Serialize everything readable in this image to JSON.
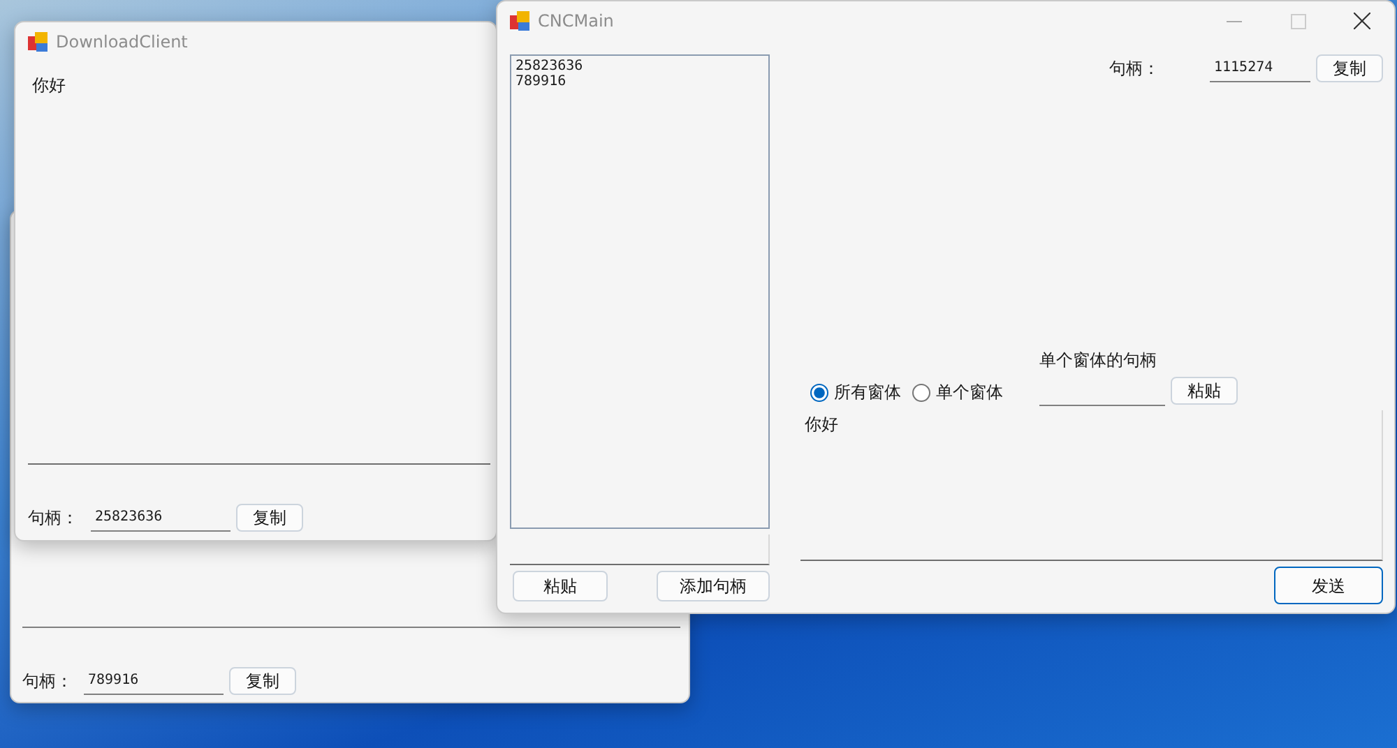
{
  "back_window": {
    "handle_label": "句柄：",
    "handle_value": "789916",
    "copy_button": "复制"
  },
  "download_client": {
    "title": "DownloadClient",
    "message": "你好",
    "handle_label": "句柄：",
    "handle_value": "25823636",
    "copy_button": "复制"
  },
  "cnc_main": {
    "title": "CNCMain",
    "handles_list": [
      "25823636",
      "789916"
    ],
    "paste_button": "粘贴",
    "add_handle_button": "添加句柄",
    "handle_label": "句柄：",
    "handle_value": "1115274",
    "copy_button": "复制",
    "targets": [
      {
        "label": "所有窗体",
        "selected": true
      },
      {
        "label": "单个窗体",
        "selected": false
      }
    ],
    "single_handle_label": "单个窗体的句柄",
    "single_paste_button": "粘贴",
    "message": "你好",
    "send_button": "发送"
  }
}
